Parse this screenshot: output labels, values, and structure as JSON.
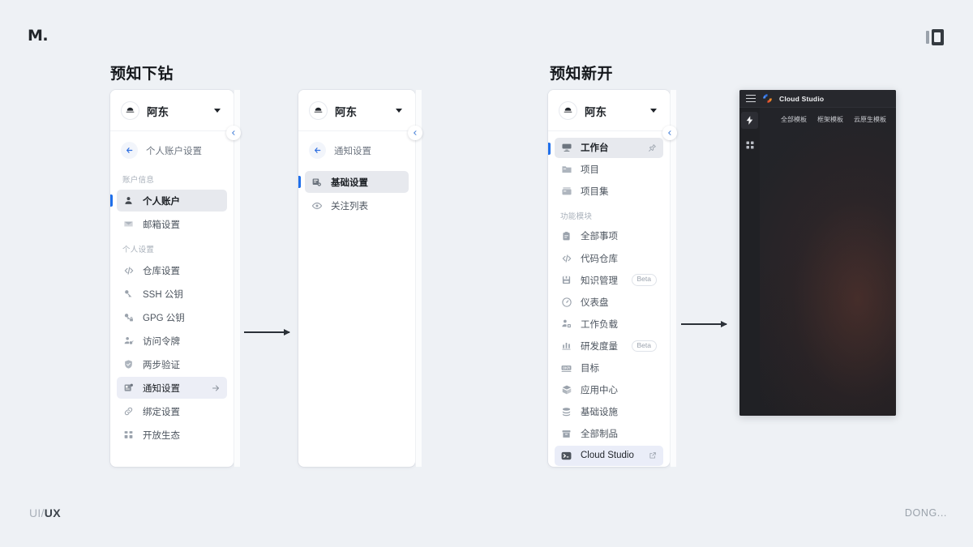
{
  "brand": {
    "logo_text": "M.",
    "corner_mark": "bracket-logo-icon"
  },
  "sections": [
    {
      "id": "s1",
      "title": "预知下钻"
    },
    {
      "id": "s2",
      "title": "预知新开"
    }
  ],
  "panel_account": {
    "workspace": {
      "name": "阿东",
      "avatar_icon": "hat-avatar-icon",
      "caret_icon": "caret-down-icon"
    },
    "back": {
      "label": "个人账户设置",
      "icon": "arrow-left-icon"
    },
    "groups": [
      {
        "label": "账户信息",
        "items": [
          {
            "label": "个人账户",
            "icon": "user-icon",
            "selected": true
          },
          {
            "label": "邮箱设置",
            "icon": "mail-icon",
            "selected": false
          }
        ]
      },
      {
        "label": "个人设置",
        "items": [
          {
            "label": "仓库设置",
            "icon": "code-icon",
            "selected": false
          },
          {
            "label": "SSH 公钥",
            "icon": "key-icon",
            "selected": false
          },
          {
            "label": "GPG 公钥",
            "icon": "key-lock-icon",
            "selected": false
          },
          {
            "label": "访问令牌",
            "icon": "user-token-icon",
            "selected": false
          },
          {
            "label": "两步验证",
            "icon": "shield-icon",
            "selected": false
          },
          {
            "label": "通知设置",
            "icon": "bell-card-icon",
            "selected": false,
            "accent": true,
            "trail_icon": "arrow-right-icon"
          },
          {
            "label": "绑定设置",
            "icon": "link-icon",
            "selected": false
          },
          {
            "label": "开放生态",
            "icon": "grid-icon",
            "selected": false
          }
        ]
      }
    ],
    "collapse_icon": "chevron-left-icon"
  },
  "panel_notify": {
    "workspace": {
      "name": "阿东",
      "avatar_icon": "hat-avatar-icon",
      "caret_icon": "caret-down-icon"
    },
    "back": {
      "label": "通知设置",
      "icon": "arrow-left-icon"
    },
    "items": [
      {
        "label": "基础设置",
        "icon": "settings-card-icon",
        "selected": true
      },
      {
        "label": "关注列表",
        "icon": "eye-icon",
        "selected": false
      }
    ],
    "collapse_icon": "chevron-left-icon"
  },
  "panel_workspace": {
    "workspace": {
      "name": "阿东",
      "avatar_icon": "hat-avatar-icon",
      "caret_icon": "caret-down-icon"
    },
    "groups": [
      {
        "label": "",
        "items": [
          {
            "label": "工作台",
            "icon": "dashboard-icon",
            "selected": true,
            "trail_icon": "pin-icon"
          },
          {
            "label": "项目",
            "icon": "folder-icon",
            "selected": false
          },
          {
            "label": "项目集",
            "icon": "folders-icon",
            "selected": false
          }
        ]
      },
      {
        "label": "功能模块",
        "items": [
          {
            "label": "全部事项",
            "icon": "clipboard-icon",
            "selected": false
          },
          {
            "label": "代码仓库",
            "icon": "code-icon",
            "selected": false
          },
          {
            "label": "知识管理",
            "icon": "book-icon",
            "selected": false,
            "badge": "Beta"
          },
          {
            "label": "仪表盘",
            "icon": "gauge-icon",
            "selected": false
          },
          {
            "label": "工作负载",
            "icon": "user-load-icon",
            "selected": false
          },
          {
            "label": "研发度量",
            "icon": "bar-chart-icon",
            "selected": false,
            "badge": "Beta"
          },
          {
            "label": "目标",
            "icon": "okr-icon",
            "selected": false
          },
          {
            "label": "应用中心",
            "icon": "box-icon",
            "selected": false
          },
          {
            "label": "基础设施",
            "icon": "database-icon",
            "selected": false
          },
          {
            "label": "全部制品",
            "icon": "archive-icon",
            "selected": false
          },
          {
            "label": "Cloud Studio",
            "icon": "terminal-icon",
            "selected": false,
            "soft": true,
            "trail_icon": "external-link-icon"
          }
        ]
      }
    ],
    "collapse_icon": "chevron-left-icon"
  },
  "cloud_studio": {
    "title": "Cloud Studio",
    "menu_icon": "hamburger-icon",
    "logo_icon": "cloud-studio-logo-icon",
    "rail": [
      {
        "icon": "lightning-icon",
        "active": true
      },
      {
        "icon": "grid-apps-icon",
        "active": false
      }
    ],
    "tabs": [
      {
        "label": "全部模板"
      },
      {
        "label": "框架模板"
      },
      {
        "label": "云原生模板"
      }
    ]
  },
  "footer": {
    "left_muted": "UI/",
    "left_strong": "UX",
    "right": "DONG..."
  },
  "colors": {
    "page_bg": "#eef1f5",
    "panel_bg": "#ffffff",
    "accent_blue": "#1f6feb",
    "selected_bg": "#e7e9ee",
    "soft_selected_bg": "#eaedf8",
    "text_primary": "#1b1f24",
    "text_secondary": "#4d555f",
    "text_muted": "#a8b0ba",
    "cs_window_bg": "#1c1d21",
    "cs_topbar_bg": "#27282d"
  }
}
